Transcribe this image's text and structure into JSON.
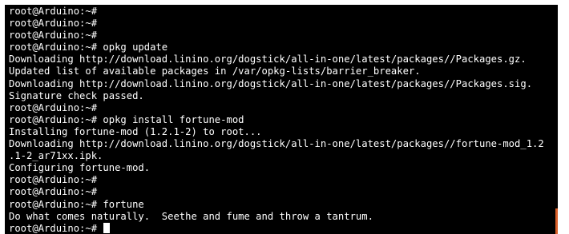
{
  "terminal": {
    "lines": [
      "root@Arduino:~#",
      "root@Arduino:~#",
      "root@Arduino:~#",
      "root@Arduino:~# opkg update",
      "Downloading http://download.linino.org/dogstick/all-in-one/latest/packages//Packages.gz.",
      "Updated list of available packages in /var/opkg-lists/barrier_breaker.",
      "Downloading http://download.linino.org/dogstick/all-in-one/latest/packages//Packages.sig.",
      "Signature check passed.",
      "root@Arduino:~#",
      "root@Arduino:~# opkg install fortune-mod",
      "Installing fortune-mod (1.2.1-2) to root...",
      "Downloading http://download.linino.org/dogstick/all-in-one/latest/packages//fortune-mod_1.2",
      ".1-2_ar71xx.ipk.",
      "Configuring fortune-mod.",
      "root@Arduino:~#",
      "root@Arduino:~#",
      "root@Arduino:~# fortune",
      "Do what comes naturally.  Seethe and fume and throw a tantrum."
    ],
    "prompt": "root@Arduino:~# ",
    "colors": {
      "background": "#000000",
      "foreground": "#ffffff",
      "scrollbar_accent": "#d9602a"
    }
  }
}
